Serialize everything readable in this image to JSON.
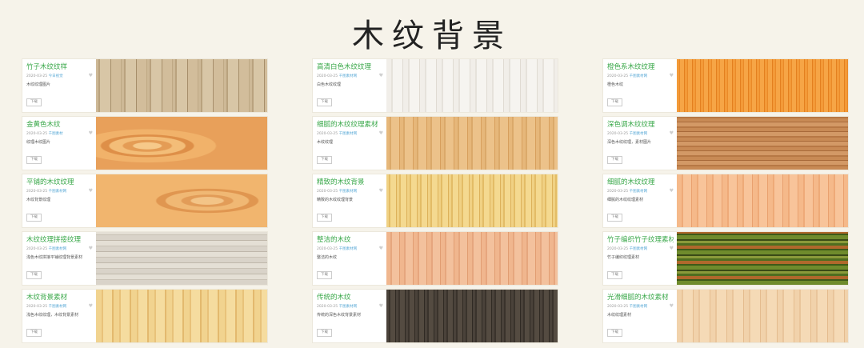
{
  "page": {
    "title": "木纹背景"
  },
  "columns": [
    {
      "items": [
        {
          "title": "竹子木纹纹样",
          "date": "2020-03-25",
          "author": "今日视觉",
          "desc": "木纹纹理图片",
          "button": "下载",
          "texture": "wood-planks-natural"
        },
        {
          "title": "金黄色木纹",
          "date": "2020-03-25",
          "author": "千图素材",
          "desc": "纹理木纹图片",
          "button": "下载",
          "texture": "golden-burl"
        },
        {
          "title": "平铺的木纹纹理",
          "date": "2020-03-25",
          "author": "千图素材网",
          "desc": "木纹背景纹理",
          "button": "下载",
          "texture": "warm-burl"
        },
        {
          "title": "木纹纹理拼接纹理",
          "date": "2020-03-25",
          "author": "千图素材网",
          "desc": "浅色木纹拼接平铺纹理背景素材",
          "button": "下载",
          "texture": "grey-parquet"
        },
        {
          "title": "木纹背景素材",
          "date": "2020-03-25",
          "author": "千图素材网",
          "desc": "浅色木纹纹理，木纹背景素材",
          "button": "下载",
          "texture": "pale-yellow-grain"
        }
      ]
    },
    {
      "items": [
        {
          "title": "高清白色木纹纹理",
          "date": "2020-03-25",
          "author": "千图素材网",
          "desc": "白色木纹纹理",
          "button": "下载",
          "texture": "white-wood"
        },
        {
          "title": "细腻的木纹纹理素材",
          "date": "2020-03-25",
          "author": "千图素材网",
          "desc": "木纹纹理",
          "button": "下载",
          "texture": "light-oak"
        },
        {
          "title": "精致的木纹背景",
          "date": "2020-03-25",
          "author": "千图素材网",
          "desc": "精致的木纹纹理背景",
          "button": "下载",
          "texture": "yellow-grain"
        },
        {
          "title": "整洁的木纹",
          "date": "2020-03-25",
          "author": "千图素材网",
          "desc": "整洁的木纹",
          "button": "下载",
          "texture": "peach-grain"
        },
        {
          "title": "传统的木纹",
          "date": "2020-03-25",
          "author": "千图素材网",
          "desc": "传统的深色木纹背景素材",
          "button": "下载",
          "texture": "dark-walnut"
        }
      ]
    },
    {
      "items": [
        {
          "title": "橙色系木纹纹理",
          "date": "2020-03-25",
          "author": "千图素材网",
          "desc": "橙色木纹",
          "button": "下载",
          "texture": "orange-grain"
        },
        {
          "title": "深色调木纹纹理",
          "date": "2020-03-25",
          "author": "千图素材网",
          "desc": "深色木纹纹理，素材图片",
          "button": "下载",
          "texture": "brown-stripe"
        },
        {
          "title": "细腻的木纹纹理",
          "date": "2020-03-25",
          "author": "千图素材网",
          "desc": "细腻的木纹纹理素材",
          "button": "下载",
          "texture": "salmon-grain"
        },
        {
          "title": "竹子编织竹子纹理素材",
          "date": "2020-03-25",
          "author": "千图素材网",
          "desc": "竹子编织纹理素材",
          "button": "下载",
          "texture": "bamboo-weave"
        },
        {
          "title": "光滑细腻的木纹素材",
          "date": "2020-03-25",
          "author": "千图素材网",
          "desc": "木纹纹理素材",
          "button": "下载",
          "texture": "beige-grain"
        }
      ]
    }
  ]
}
